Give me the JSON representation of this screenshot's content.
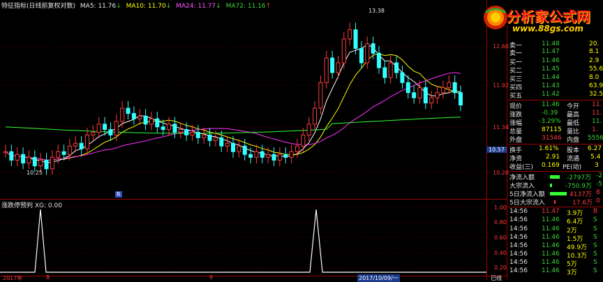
{
  "chart_header": {
    "title": "特征指标(日线前复权对数)",
    "ma5": "MA5: 11.76",
    "ma10": "MA10: 11.70",
    "ma24": "MA24: 11.77",
    "ma72": "MA72: 11.16",
    "arrow_down": "↓",
    "arrow_up": "↑"
  },
  "high_marker": "13.38",
  "low_marker": "10.25",
  "badge_r": "R",
  "current_price_tag": "10.57",
  "price_axis": [
    "12.60",
    "11.92",
    "11.34",
    "10.26"
  ],
  "indicator_header": "涨跌停预判 XG: 0.00",
  "indicator_axis": [
    "1.00",
    "0.80",
    "0.60",
    "0.40",
    "0.20"
  ],
  "bottom_dates": [
    "2017年",
    "8",
    "9",
    "2017/10/09/一",
    "已线"
  ],
  "colors": {
    "up": "#ff3c3c",
    "down": "#33ffff",
    "ma5": "#ffffff",
    "ma10": "#ffff00",
    "ma24": "#ff33ff",
    "ma72": "#33ff33",
    "grid_red": "#a00000"
  },
  "watermark": {
    "title": "分析家公式网",
    "url": "www.88gs.com"
  },
  "quotes": [
    {
      "label": "卖一",
      "price": "11.48",
      "vol": "20."
    },
    {
      "label": "卖一",
      "price": "11.47",
      "vol": "8.1"
    },
    {
      "label": "买一",
      "price": "11.46",
      "vol": "2.9"
    },
    {
      "label": "买二",
      "price": "11.45",
      "vol": "55.6"
    },
    {
      "label": "买三",
      "price": "11.44",
      "vol": "8.0"
    },
    {
      "label": "买四",
      "price": "11.43",
      "vol": "63.9"
    },
    {
      "label": "买五",
      "price": "11.42",
      "vol": "32.5"
    }
  ],
  "stats": [
    {
      "l1": "现价",
      "v1": "11.46",
      "l2": "今开",
      "v2": "11."
    },
    {
      "l1": "涨跌",
      "v1": "-0.39",
      "l2": "最高",
      "v2": "11."
    },
    {
      "l1": "涨幅",
      "v1": "-3.29%",
      "l2": "最低",
      "v2": "11."
    },
    {
      "l1": "总量",
      "v1": "87115",
      "l2": "量比",
      "v2": "1."
    },
    {
      "l1": "外盘",
      "v1": "31546",
      "l2": "内盘",
      "v2": "5556"
    }
  ],
  "fundamentals": [
    {
      "l1": "换手",
      "v1": "1.61%",
      "l2": "股本",
      "v2": "6.27"
    },
    {
      "l1": "净资",
      "v1": "2.91",
      "l2": "流通",
      "v2": "5.4"
    },
    {
      "l1": "收益(三)",
      "v1": "0.169",
      "l2": "PE(动)",
      "v2": "3"
    }
  ],
  "flows": [
    {
      "label": "净流入额",
      "value": "-2797万",
      "tail": "-2"
    },
    {
      "label": "大宗流入",
      "value": "-750.9万",
      "tail": "-5"
    },
    {
      "label": "5日净流入额",
      "value": "4137万",
      "tail": "8"
    },
    {
      "label": "5日大宗流入",
      "value": "17.6万",
      "tail": "0"
    }
  ],
  "ticks": [
    {
      "time": "14:56",
      "price": "11.47",
      "vol": "3.9万",
      "bs": "B"
    },
    {
      "time": "14:56",
      "price": "11.46",
      "vol": "6.4万",
      "bs": "S"
    },
    {
      "time": "14:56",
      "price": "11.46",
      "vol": "2万",
      "bs": "S"
    },
    {
      "time": "14:56",
      "price": "11.46",
      "vol": "1.5万",
      "bs": "S"
    },
    {
      "time": "14:56",
      "price": "11.46",
      "vol": "49.9万",
      "bs": "S"
    },
    {
      "time": "14:56",
      "price": "11.46",
      "vol": "10.3万",
      "bs": "S"
    },
    {
      "time": "14:56",
      "price": "11.46",
      "vol": "5万",
      "bs": "S"
    },
    {
      "time": "14:56",
      "price": "11.46",
      "vol": "3万",
      "bs": "S"
    }
  ]
}
